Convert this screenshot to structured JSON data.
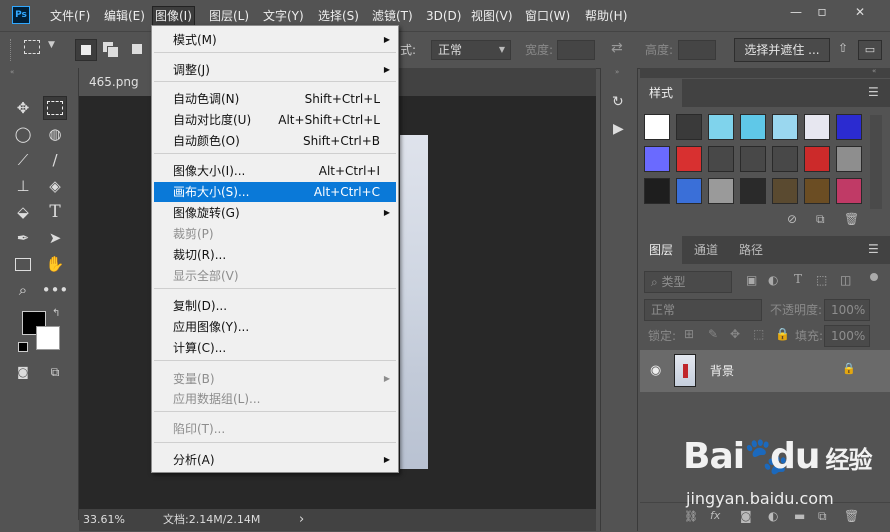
{
  "menubar": {
    "logo": "Ps",
    "items": [
      "文件(F)",
      "编辑(E)",
      "图像(I)",
      "图层(L)",
      "文字(Y)",
      "选择(S)",
      "滤镜(T)",
      "3D(D)",
      "视图(V)",
      "窗口(W)",
      "帮助(H)"
    ],
    "active_index": 2
  },
  "window_controls": {
    "minimize": "—",
    "restore": "▫",
    "close": "✕"
  },
  "options_bar": {
    "style_label": "式:",
    "style_value": "正常",
    "width_label": "宽度:",
    "height_label": "高度:",
    "select_mask_button": "选择并遮住 ...",
    "swap_icon": "⇄"
  },
  "document": {
    "tab_title": "465.png @"
  },
  "status_bar": {
    "zoom": "33.61%",
    "doc_info": "文档:2.14M/2.14M",
    "arrow": "›"
  },
  "image_menu": {
    "items": [
      {
        "label": "模式(M)",
        "shortcut": "",
        "submenu": true,
        "disabled": false
      },
      {
        "sep": true
      },
      {
        "label": "调整(J)",
        "shortcut": "",
        "submenu": true,
        "disabled": false
      },
      {
        "sep": true
      },
      {
        "label": "自动色调(N)",
        "shortcut": "Shift+Ctrl+L",
        "submenu": false,
        "disabled": false
      },
      {
        "label": "自动对比度(U)",
        "shortcut": "Alt+Shift+Ctrl+L",
        "submenu": false,
        "disabled": false
      },
      {
        "label": "自动颜色(O)",
        "shortcut": "Shift+Ctrl+B",
        "submenu": false,
        "disabled": false
      },
      {
        "sep": true
      },
      {
        "label": "图像大小(I)...",
        "shortcut": "Alt+Ctrl+I",
        "submenu": false,
        "disabled": false
      },
      {
        "label": "画布大小(S)...",
        "shortcut": "Alt+Ctrl+C",
        "submenu": false,
        "disabled": false,
        "highlighted": true
      },
      {
        "label": "图像旋转(G)",
        "shortcut": "",
        "submenu": true,
        "disabled": false
      },
      {
        "label": "裁剪(P)",
        "shortcut": "",
        "submenu": false,
        "disabled": true
      },
      {
        "label": "裁切(R)...",
        "shortcut": "",
        "submenu": false,
        "disabled": false
      },
      {
        "label": "显示全部(V)",
        "shortcut": "",
        "submenu": false,
        "disabled": true
      },
      {
        "sep": true
      },
      {
        "label": "复制(D)...",
        "shortcut": "",
        "submenu": false,
        "disabled": false
      },
      {
        "label": "应用图像(Y)...",
        "shortcut": "",
        "submenu": false,
        "disabled": false
      },
      {
        "label": "计算(C)...",
        "shortcut": "",
        "submenu": false,
        "disabled": false
      },
      {
        "sep": true
      },
      {
        "label": "变量(B)",
        "shortcut": "",
        "submenu": true,
        "disabled": true
      },
      {
        "label": "应用数据组(L)...",
        "shortcut": "",
        "submenu": false,
        "disabled": true
      },
      {
        "sep": true
      },
      {
        "label": "陷印(T)...",
        "shortcut": "",
        "submenu": false,
        "disabled": true
      },
      {
        "sep": true
      },
      {
        "label": "分析(A)",
        "shortcut": "",
        "submenu": true,
        "disabled": false
      }
    ]
  },
  "styles_panel": {
    "tab": "样式",
    "swatch_colors": [
      "#ffffff",
      "#3a3a3a",
      "#7fd3ec",
      "#5fc8e8",
      "#9ad7ef",
      "#e7e7f0",
      "#2b2bd0",
      "#6a6aff",
      "#d83030",
      "#484848",
      "#484848",
      "#484848",
      "#cc2a2a",
      "#8e8e8e",
      "#1e1e1e",
      "#3a6fd8",
      "#9a9a9a",
      "#2a2a2a",
      "#5a4a30",
      "#6b4d23",
      "#c03a66"
    ]
  },
  "layers_panel": {
    "tabs": [
      "图层",
      "通道",
      "路径"
    ],
    "filter_label": "类型",
    "blend_mode": "正常",
    "opacity_label": "不透明度:",
    "opacity_value": "100%",
    "lock_label": "锁定:",
    "fill_label": "填充:",
    "fill_value": "100%",
    "layer_name": "背景"
  },
  "watermark": {
    "brand": "Bai",
    "brand2": "du",
    "brand3": "经验",
    "url": "jingyan.baidu.com"
  }
}
